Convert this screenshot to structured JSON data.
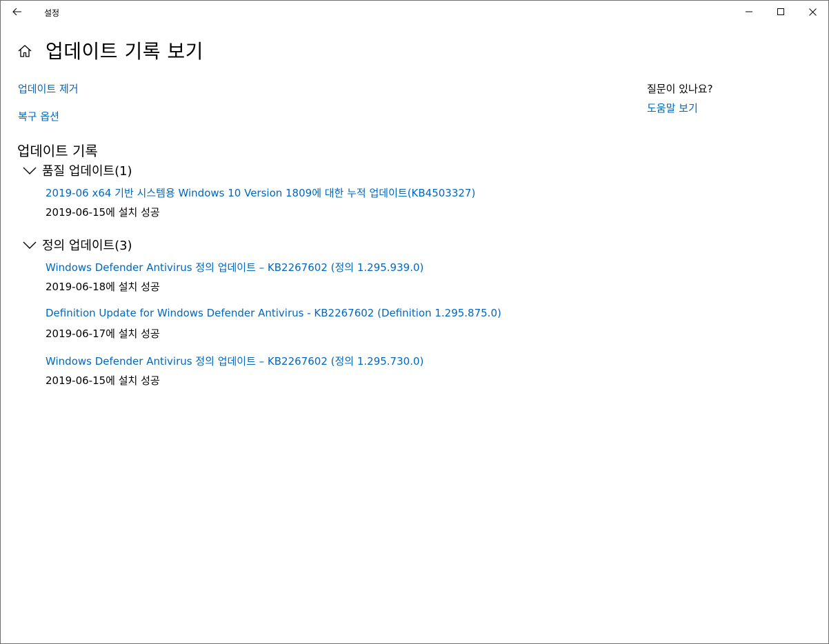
{
  "window": {
    "app_title": "설정"
  },
  "header": {
    "title": "업데이트 기록 보기"
  },
  "links": {
    "uninstall": "업데이트 제거",
    "recovery": "복구 옵션"
  },
  "aside": {
    "question": "질문이 있나요?",
    "help_link": "도움말 보기"
  },
  "history": {
    "section_title": "업데이트 기록",
    "groups": [
      {
        "label": "품질 업데이트(1)",
        "items": [
          {
            "title": "2019-06 x64 기반 시스템용 Windows 10 Version 1809에 대한 누적 업데이트(KB4503327)",
            "status": "2019-06-15에 설치 성공"
          }
        ]
      },
      {
        "label": "정의 업데이트(3)",
        "items": [
          {
            "title": "Windows Defender Antivirus 정의 업데이트 – KB2267602 (정의 1.295.939.0)",
            "status": "2019-06-18에 설치 성공"
          },
          {
            "title": "Definition Update for Windows Defender Antivirus - KB2267602 (Definition 1.295.875.0)",
            "status": "2019-06-17에 설치 성공"
          },
          {
            "title": "Windows Defender Antivirus 정의 업데이트 – KB2267602 (정의 1.295.730.0)",
            "status": "2019-06-15에 설치 성공"
          }
        ]
      }
    ]
  },
  "colors": {
    "link": "#0067c0",
    "text": "#000000",
    "background": "#ffffff"
  },
  "icons": {
    "back": "back-arrow-icon",
    "home": "home-icon",
    "minimize": "minimize-icon",
    "maximize": "maximize-icon",
    "close": "close-icon",
    "expand": "chevron-down-icon"
  }
}
